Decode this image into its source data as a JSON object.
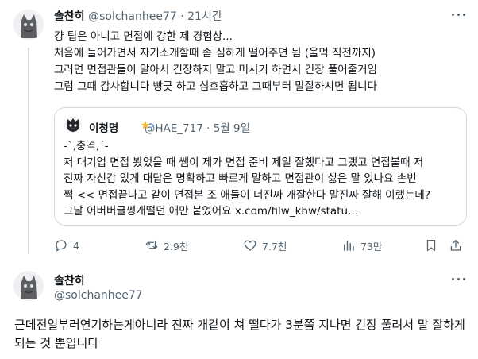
{
  "tweet1": {
    "name": "솔찬히",
    "handle": "@solchanhee77",
    "separator": "·",
    "time": "21시간",
    "lines": [
      "걍 팁은 아니고 면접에 강한 제 경험상...",
      "처음에 들어가면서 자기소개할때 좀 심하게 떨어주면 됨 (울먹 직전까지)",
      "그러면 면접관들이 알아서 긴장하지 말고 머시기 하면서 긴장 풀어줄거임",
      "그럼 그때 감사합니다 빵긋 하고 심호흡하고 그때부터 말잘하시면 됩니다"
    ],
    "quote": {
      "name": "이청명",
      "handle": "@HAE_717",
      "separator": "·",
      "date": "5월 9일",
      "lines": [
        "-`,충격,´-",
        "저 대기업 면접 봤었을 때 쌤이 제가 면접 준비 제일 잘했다고 그랬고 면접볼때 저",
        "진짜 자신감 있게 대답은 명확하고 빠르게 말하고 면접관이 싫은 말 있나요 손번",
        "쩍 << 면접끝나고 같이 면접본 조 애들이 너진짜 개잘한다 말진짜 잘해 이랬는데?",
        "그날 어버버글썽개떨던 애만 붙었어요 x.com/filw_khw/statu…"
      ]
    },
    "actions": {
      "replies": "4",
      "retweets": "2.9천",
      "likes": "7.7천",
      "views": "73만"
    }
  },
  "tweet2": {
    "name": "솔찬히",
    "handle": "@solchanhee77",
    "text": "근데전일부러연기하는게아니라 진짜 개같이 쳐 떨다가 3분쯤 지나면 긴장 풀려서 말 잘하게되는 것 뿐입니다"
  },
  "icons": {
    "reply": "reply-icon",
    "retweet": "retweet-icon",
    "like": "heart-icon",
    "views": "views-icon",
    "bookmark": "bookmark-icon",
    "share": "share-icon",
    "more": "more-icon"
  },
  "colors": {
    "text": "#0f1419",
    "secondary": "#536471",
    "border": "#cfd9de"
  }
}
